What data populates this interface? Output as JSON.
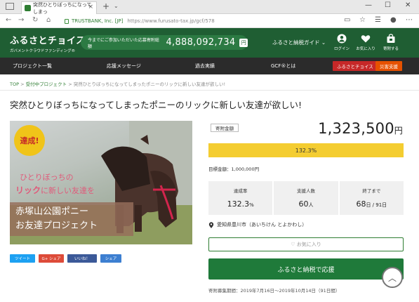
{
  "browser": {
    "tab_title": "突然ひとりぼっちになってしまっ",
    "tab_close": "×",
    "new_tab": "+",
    "tab_menu": "⌄",
    "win_min": "—",
    "win_max": "☐",
    "win_close": "✕",
    "nav_back": "←",
    "nav_forward": "→",
    "nav_reload": "↻",
    "nav_home": "⌂",
    "site_identity": "TRUSTBANK, Inc. [JP]",
    "url": "https://www.furusato-tax.jp/gcf/578"
  },
  "header": {
    "logo_main": "ふるさとチョイス",
    "logo_sub": "ガバメントクラウドファンディング®",
    "total_label": "今までにご参加いただいた応募寄附総額",
    "total_value": "4,888,092,734",
    "total_unit": "円",
    "guide": "ふるさと納税ガイド ⌄",
    "login": "ログイン",
    "favorites": "お気に入り",
    "donate_record": "寄附する"
  },
  "nav": {
    "items": [
      "プロジェクト一覧",
      "応援メッセージ",
      "過去実績",
      "GCF®とは"
    ],
    "choice_btn": "ふるさとチョイス",
    "disaster_btn": "災害支援"
  },
  "breadcrumb": {
    "top": "TOP",
    "sep": ">",
    "category": "受付中プロジェクト",
    "current": "突然ひとりぼっちになってしまったポニーのリックに新しい友達が欲しい!"
  },
  "page_title": "突然ひとりぼっちになってしまったポニーのリックに新しい友達が欲しい!",
  "hero": {
    "badge": "達成!",
    "sub1": "ひとりぼっちの",
    "sub2_strong": "リック",
    "sub2_rest": "に新しい友達を",
    "title_line1": "赤塚山公園ポニー",
    "title_line2": "お友達プロジェクト"
  },
  "share": {
    "tweet": "ツイート",
    "gplus": "G+ シェア",
    "like": "いいね！",
    "share": "シェア"
  },
  "donation": {
    "label": "寄附金額",
    "amount": "1,323,500",
    "yen": "円",
    "progress_text": "132.3%",
    "progress_value": 1.0,
    "target": "目標金額：1,000,000円"
  },
  "stats": [
    {
      "key": "達成率",
      "value": "132.3",
      "unit": "%"
    },
    {
      "key": "支援人数",
      "value": "60",
      "unit": "人"
    },
    {
      "key": "終了まで",
      "value": "68",
      "unit": "日 / 91日"
    }
  ],
  "location": "愛知県豊川市（あいちけん とよかわし）",
  "buttons": {
    "favorite": "♡ お気に入り",
    "apply": "ふるさと納税で応援",
    "scroll_top": "︿"
  },
  "period": "寄附募集期間：2019年7月16日～2019年10月14日（91日間）",
  "colors": {
    "brand_green": "#1f5e33",
    "progress_yellow": "#f4cd31",
    "choice_red": "#c62828",
    "disaster_orange": "#e65100",
    "twitter": "#1da1f2",
    "gplus": "#dd4b39",
    "facebook": "#3b5998",
    "hatena": "#3d7fd1"
  }
}
